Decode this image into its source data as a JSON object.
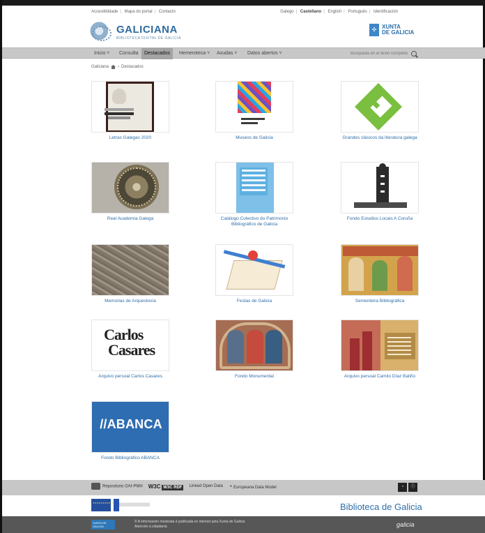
{
  "utility_links": {
    "left": [
      "Accesibilidade",
      "Mapa do portal",
      "Contacto"
    ],
    "right": [
      "Galego",
      "Castellano",
      "English",
      "Português",
      "Identificación"
    ]
  },
  "brand": {
    "title": "GALICIANA",
    "subtitle": "BIBLIOTECA DIXITAL DE GALICIA"
  },
  "partner_brand": {
    "line1": "XUNTA",
    "line2": "DE GALICIA"
  },
  "nav": {
    "items": [
      "Inicio",
      "Consulta",
      "Destacados",
      "Hemeroteca",
      "Axudas",
      "Datos abertos"
    ],
    "search_placeholder": "Búsqueda en el texto completo"
  },
  "breadcrumb": {
    "root": "Galiciana",
    "current": "Destacados"
  },
  "collections": [
    {
      "caption": "Letras Galegas 2020"
    },
    {
      "caption": "Museos de Galicia"
    },
    {
      "caption": "Grandes clásicos da literatura galega"
    },
    {
      "caption": "Real Academia Galega"
    },
    {
      "caption": "Catálogo Colectivo do Patrimonio Bibliográfico de Galicia"
    },
    {
      "caption": "Fondo Estudios Locais A Coruña"
    },
    {
      "caption": "Memorias de Arqueoloxía"
    },
    {
      "caption": "Festas de Galicia"
    },
    {
      "caption": "Sementeira Bibliográfica"
    },
    {
      "caption": "Arquivo persoal Carlos Casares"
    },
    {
      "caption": "Fondo Monumental"
    },
    {
      "caption": "Arquivo persoal Camilo Díaz Baliño"
    },
    {
      "caption": "Fondo Bibliográfico ABANCA"
    }
  ],
  "thumb_text": {
    "carlos_line1": "Carlos",
    "carlos_line2": "Casares",
    "abanca": "//ABANCA"
  },
  "footer": {
    "links": [
      "Repositorio OAI-PMH",
      "W3C RDF",
      "Linked Open Data",
      "Europeana Data Model"
    ],
    "library": "Biblioteca de Galicia",
    "gov_text_line1": "© A información mostrada é publicada en internet pola Xunta de Galicia",
    "gov_text_line2": "Atención á cidadanía",
    "gov_logo": "XUNTA DE GALICIA",
    "galicia": "galicia"
  }
}
